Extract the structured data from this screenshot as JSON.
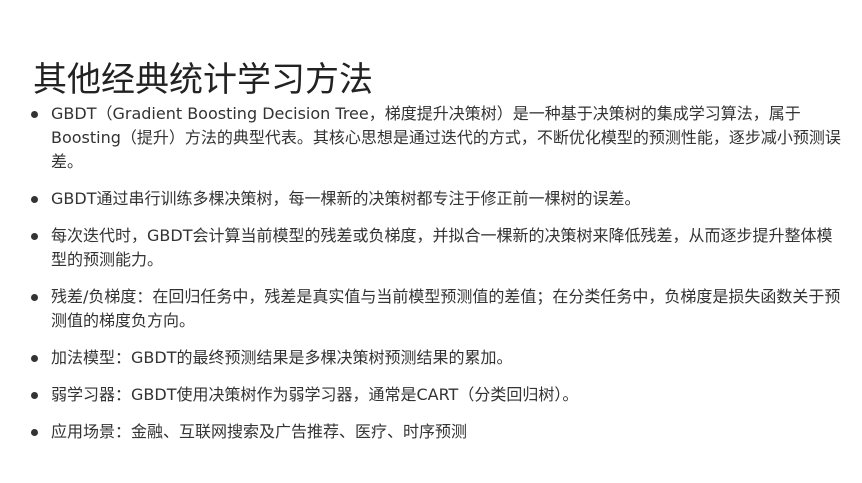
{
  "slide": {
    "title": "其他经典统计学习方法",
    "bullets": [
      {
        "text": "GBDT（Gradient Boosting Decision Tree，梯度提升决策树）是一种基于决策树的集成学习算法，属于Boosting（提升）方法的典型代表。其核心思想是通过迭代的方式，不断优化模型的预测性能，逐步减小预测误差。"
      },
      {
        "text": "GBDT通过串行训练多棵决策树，每一棵新的决策树都专注于修正前一棵树的误差。"
      },
      {
        "text": "每次迭代时，GBDT会计算当前模型的残差或负梯度，并拟合一棵新的决策树来降低残差，从而逐步提升整体模型的预测能力。"
      },
      {
        "text": "残差/负梯度：在回归任务中，残差是真实值与当前模型预测值的差值；在分类任务中，负梯度是损失函数关于预测值的梯度负方向。"
      },
      {
        "text": "加法模型：GBDT的最终预测结果是多棵决策树预测结果的累加。"
      },
      {
        "text": "弱学习器：GBDT使用决策树作为弱学习器，通常是CART（分类回归树）。"
      },
      {
        "text": "应用场景：金融、互联网搜索及广告推荐、医疗、时序预测"
      }
    ]
  }
}
